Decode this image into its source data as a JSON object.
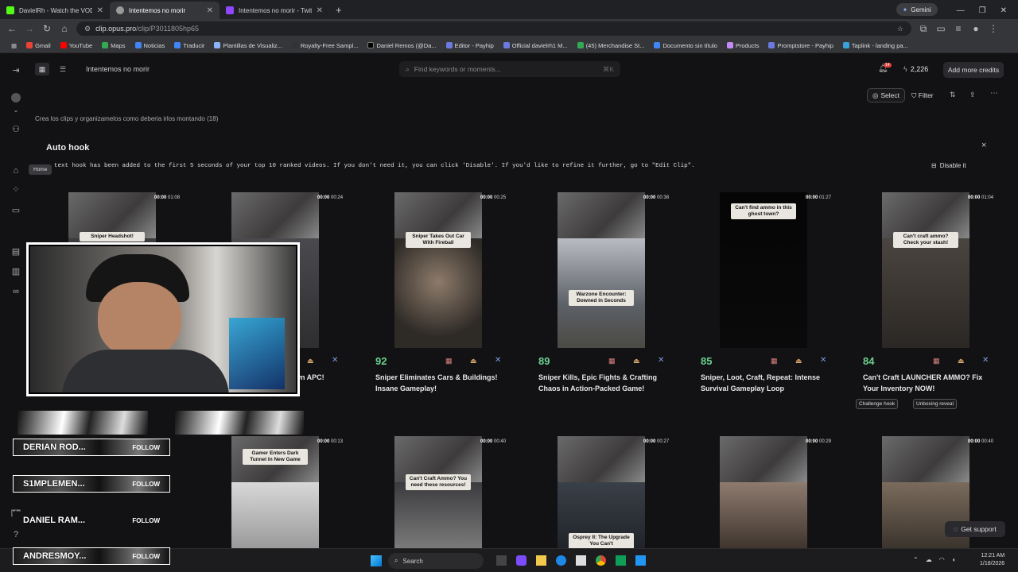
{
  "browser": {
    "tabs": [
      {
        "title": "DavielRh - Watch the VOD on K",
        "color": "#53fc18",
        "active": false
      },
      {
        "title": "Intentemos no morir",
        "color": "#9a9a9a",
        "active": true
      },
      {
        "title": "Intentemos no morir - Twitch",
        "color": "#9146ff",
        "active": false
      }
    ],
    "new_tab": "+",
    "gemini": "Gemini",
    "url_host": "clip.opus.pro",
    "url_path": "/clip/P3011805hp65",
    "bookmarks": [
      "Gmail",
      "YouTube",
      "Maps",
      "Noticias",
      "Traducir",
      "Plantillas de Visualiz...",
      "Royalty-Free Sampl...",
      "Daniel Remos (@Da...",
      "Editor - Payhip",
      "Official davielrh1 M...",
      "(45) Merchandise St...",
      "Documento sin título",
      "Products",
      "Promptstore - Payhip",
      "Taplink - landing pa..."
    ]
  },
  "app": {
    "project_name": "Intentemos no morir",
    "search_placeholder": "Find keywords or moments...",
    "search_shortcut": "⌘K",
    "notif_count": "14",
    "credits": "2,226",
    "add_credits": "Add more credits",
    "select": "Select",
    "filter": "Filter",
    "prompt_text": "Crea los clips y organizamelos como deberia irlos montando",
    "prompt_count": "(18)",
    "home_tooltip": "Home"
  },
  "autohook": {
    "title": "Auto hook",
    "message": "text hook has been added to the first 5 seconds of your top 10 ranked videos. If you don't need it, you can click 'Disable'. If you'd like to refine it further, go to \"Edit Clip\".",
    "disable": "Disable it",
    "close": "×"
  },
  "clips_row1": [
    {
      "start": "00:00",
      "end": "01:08",
      "caption": "Sniper Headshot!",
      "score": "",
      "title": "",
      "tags": []
    },
    {
      "start": "00:00",
      "end": "00:24",
      "caption": "",
      "score": "",
      "title": "wn APC!",
      "tags": []
    },
    {
      "start": "00:00",
      "end": "00:25",
      "caption": "Sniper Takes Out Car With Fireball",
      "score": "92",
      "title": "Sniper Eliminates Cars & Buildings! Insane Gameplay!",
      "tags": []
    },
    {
      "start": "00:00",
      "end": "00:38",
      "caption": "Warzone Encounter: Downed in Seconds",
      "score": "89",
      "title": "Sniper Kills, Epic Fights & Crafting Chaos in Action-Packed Game!",
      "tags": []
    },
    {
      "start": "00:00",
      "end": "01:27",
      "caption": "Can't find ammo in this ghost town?",
      "score": "85",
      "title": "Sniper, Loot, Craft, Repeat: Intense Survival Gameplay Loop",
      "tags": []
    },
    {
      "start": "00:00",
      "end": "01:04",
      "caption": "Can't craft ammo? Check your stash!",
      "score": "84",
      "title": "Can't Craft LAUNCHER AMMO? Fix Your Inventory NOW!",
      "tags": [
        "Challenge hook",
        "Unboxing reveal"
      ]
    }
  ],
  "clips_row2": [
    {
      "start": "00:00",
      "end": "00:13",
      "caption": "Gamer Enters Dark Tunnel In New Game"
    },
    {
      "start": "00:00",
      "end": "00:40",
      "caption": "Can't Craft Ammo? You need these resources!"
    },
    {
      "start": "00:00",
      "end": "00:27",
      "caption": "Osprey II: The Upgrade You Can't"
    },
    {
      "start": "00:00",
      "end": "00:29",
      "caption": ""
    },
    {
      "start": "00:00",
      "end": "00:40",
      "caption": ""
    }
  ],
  "overlay": {
    "followers": [
      {
        "name": "DERIAN ROD...",
        "action": "FOLLOW"
      },
      {
        "name": "S1MPLEMEN...",
        "action": "FOLLOW"
      },
      {
        "name": "DANIEL RAM...",
        "action": "FOLLOW"
      },
      {
        "name": "ANDRESMOY...",
        "action": "FOLLOW"
      }
    ]
  },
  "support": "Get support",
  "taskbar": {
    "search": "Search",
    "time": "12:21 AM",
    "date": "1/18/2026"
  }
}
